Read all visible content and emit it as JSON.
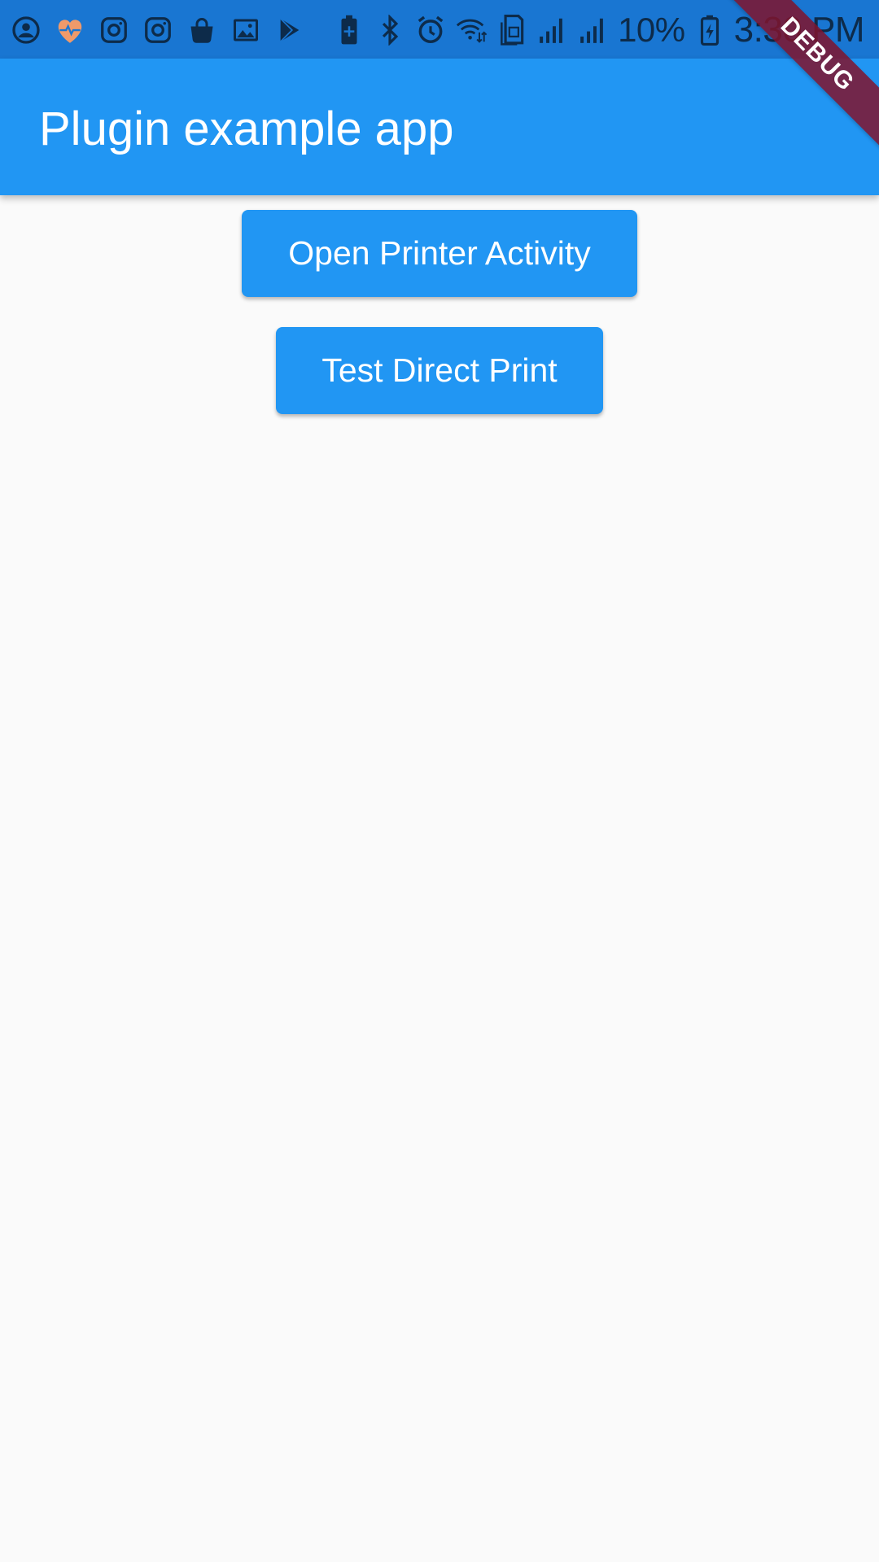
{
  "status_bar": {
    "left_icons": [
      "account-circle-icon",
      "heart-pulse-icon",
      "instagram-icon",
      "instagram-icon",
      "shopping-bag-icon",
      "image-icon",
      "play-store-icon"
    ],
    "right_icons": [
      "battery-saver-icon",
      "bluetooth-icon",
      "alarm-icon",
      "wifi-icon",
      "sim-card-icon",
      "signal-icon",
      "signal-icon"
    ],
    "battery_percent": "10%",
    "time": "3:30 PM",
    "heart_color": "#ef9a6a"
  },
  "app_bar": {
    "title": "Plugin example app",
    "color": "#2196f3"
  },
  "buttons": {
    "open_printer_activity": "Open Printer Activity",
    "test_direct_print": "Test Direct Print"
  },
  "debug_banner": {
    "label": "DEBUG"
  }
}
